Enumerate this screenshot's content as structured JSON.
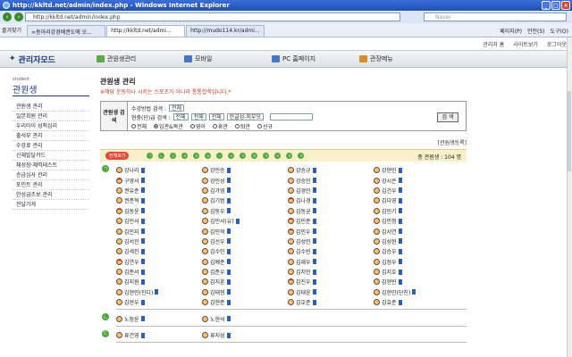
{
  "window": {
    "title": "http://kkltd.net/admin/index.php - Windows Internet Explorer"
  },
  "address": {
    "url": "http://kkltd.net/admin/index.php",
    "search_placeholder": "Naver"
  },
  "tabbar": {
    "favorites": "즐겨찾기",
    "tabs": [
      "∞동아리강경배권도에 오...",
      "http://kkltd.net/admi...",
      "http://mudo114.kr/admi..."
    ],
    "tools": [
      "페이지(P)",
      "안전(S)",
      "도구(O)"
    ]
  },
  "toplinks": [
    "관리자 홈",
    "사이트보기",
    "로그아웃"
  ],
  "logo": "관리자모드",
  "menu": [
    "관원생관리",
    "모바일",
    "PC 홈페이지",
    "관장메뉴"
  ],
  "sidebar": {
    "small": "student",
    "title": "관원생",
    "items": [
      "관원생 관리",
      "일본회원 관리",
      "우리아이 성적심리",
      "출석부 관리",
      "수강료 관리",
      "신체발달카드",
      "체성장·체력테스트",
      "승급심사 관리",
      "포인트 관리",
      "안성급츠보 관리",
      "전달가게"
    ]
  },
  "content": {
    "title": "관원생 관리",
    "notice": "※해당 운동하나 시키는 스포츠가 아니라 통통합학입니다.*",
    "search_label": "관원생 검색",
    "row1_label": "수강방법 검색 :",
    "row1_select": "전체",
    "row2_label": "현충(단)급 검색 :",
    "row2_selects": [
      "전체",
      "전체",
      "전체",
      "한글성-외부모"
    ],
    "radios": [
      "전체",
      "입관&복관",
      "영어",
      "휴관",
      "퇴관",
      "신규"
    ],
    "radio_selected": 1,
    "search_button": "검 색",
    "register": "[관원생등록]",
    "all_button": "전체보기",
    "initials": [
      "ㄱ",
      "ㄴ",
      "ㄷ",
      "ㄹ",
      "ㅁ",
      "ㅂ",
      "ㅅ",
      "ㅇ",
      "ㅈ",
      "ㅊ",
      "ㅋ",
      "ㅌ",
      "ㅍ",
      "ㅎ"
    ],
    "total": "총 관원생 : 104 명"
  },
  "group1": {
    "initial": "ㄱ",
    "members": [
      "강나리",
      "강민승",
      "강승규",
      "강현민",
      "구영서",
      "강민성",
      "강승민",
      "강시은",
      "권유준",
      "김가영",
      "김경민",
      "김건우",
      "권준혁",
      "김기범",
      "김나경",
      "김다영",
      "김동윤",
      "김동우",
      "김동균",
      "김민기",
      "김민서",
      "김민서(유)",
      "김민준",
      "김민정",
      "김민지",
      "김민혁",
      "김민우",
      "김서연",
      "김서진",
      "김선우",
      "김성민",
      "김성현",
      "김세진",
      "김수민",
      "김수빈",
      "김승우",
      "김연우",
      "김예준",
      "김재우",
      "김정우",
      "김준서",
      "김준우",
      "김지민",
      "김지호",
      "김지원",
      "김지훈",
      "김진우",
      "김현빈",
      "김현민(진디)",
      "김태형",
      "김태윤",
      "김현민(단진)",
      "김현우",
      "김현준",
      "김호준",
      "김효준"
    ],
    "face_red": [
      4,
      14,
      16,
      22,
      26,
      36,
      46
    ]
  },
  "group2": {
    "initial": "ㄴ",
    "members": [
      "노정윤",
      "노현석"
    ]
  },
  "group3": {
    "initial": "ㄷ",
    "members": [
      "류건영",
      "류지성"
    ]
  }
}
